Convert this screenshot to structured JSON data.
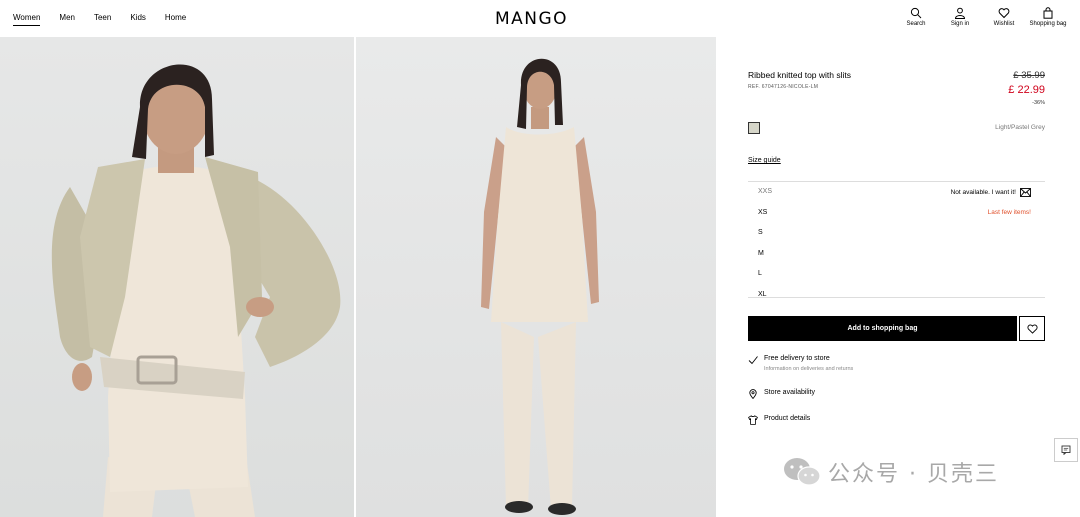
{
  "nav": {
    "items": [
      "Women",
      "Men",
      "Teen",
      "Kids",
      "Home"
    ],
    "active": "Women"
  },
  "brand": {
    "logo": "MANGO"
  },
  "header_actions": [
    {
      "label": "Search",
      "icon": "search-icon"
    },
    {
      "label": "Sign in",
      "icon": "user-icon"
    },
    {
      "label": "Wishlist",
      "icon": "heart-icon"
    },
    {
      "label": "Shopping bag",
      "icon": "bag-icon"
    }
  ],
  "product": {
    "title": "Ribbed knitted top with slits",
    "ref": "REF. 67047126-NICOLE-LM",
    "old_price": "£ 35.99",
    "new_price": "£ 22.99",
    "discount": "-36%",
    "color_name": "Light/Pastel Grey",
    "swatch_color": "#d6d6c9",
    "size_guide": "Size guide",
    "sizes": [
      {
        "size": "XXS",
        "note": "Not available. I want it!",
        "status": "unavailable"
      },
      {
        "size": "XS",
        "note": "Last few items!",
        "status": "low"
      },
      {
        "size": "S",
        "note": "",
        "status": "available"
      },
      {
        "size": "M",
        "note": "",
        "status": "available"
      },
      {
        "size": "L",
        "note": "",
        "status": "available"
      },
      {
        "size": "XL",
        "note": "",
        "status": "available"
      }
    ],
    "add_to_bag": "Add to shopping bag"
  },
  "info": {
    "delivery_title": "Free delivery to store",
    "delivery_sub": "Information on deliveries and returns",
    "store_availability": "Store availability",
    "product_details": "Product details"
  },
  "colors": {
    "accent_red": "#d0021b",
    "warn_orange": "#e0502b",
    "button_black": "#000000"
  },
  "watermark": {
    "text": "公众号 · 贝壳三"
  }
}
